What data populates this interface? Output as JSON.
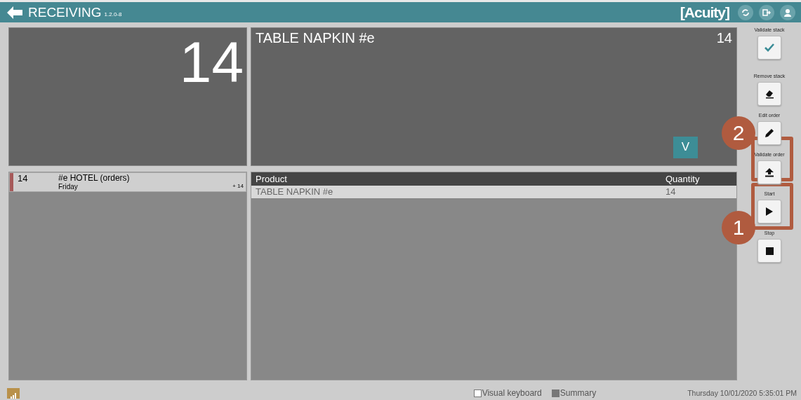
{
  "header": {
    "title": "RECEIVING",
    "version": "1.2.0-8",
    "logo": "[Acuity]"
  },
  "count_panel": {
    "value": "14"
  },
  "product_panel": {
    "name": "TABLE NAPKIN #e",
    "quantity": "14",
    "button": "V"
  },
  "orders": [
    {
      "number": "14",
      "name": "#e HOTEL (orders)",
      "day": "Friday",
      "delta": "+ 14",
      "color": "#a65a5a",
      "selected": true
    }
  ],
  "table": {
    "columns": [
      "Product",
      "Quantity"
    ],
    "rows": [
      [
        "TABLE NAPKIN #e",
        "14"
      ]
    ]
  },
  "toolbar": [
    {
      "label": "Validate stack",
      "kind": "check"
    },
    {
      "label": "Remove stack",
      "kind": "eraser"
    },
    {
      "label": "Edit order",
      "kind": "pencil"
    },
    {
      "label": "Validate order",
      "kind": "upload"
    },
    {
      "label": "Start",
      "kind": "play"
    },
    {
      "label": "Stop",
      "kind": "stop"
    }
  ],
  "annotations": [
    {
      "label": "2"
    },
    {
      "label": "1"
    }
  ],
  "status_bar": {
    "checkboxes": [
      {
        "label": "Visual keyboard",
        "checked": false
      },
      {
        "label": "Summary",
        "checked": true
      }
    ],
    "datetime": "Thursday 10/01/2020 5:35:01 PM"
  }
}
